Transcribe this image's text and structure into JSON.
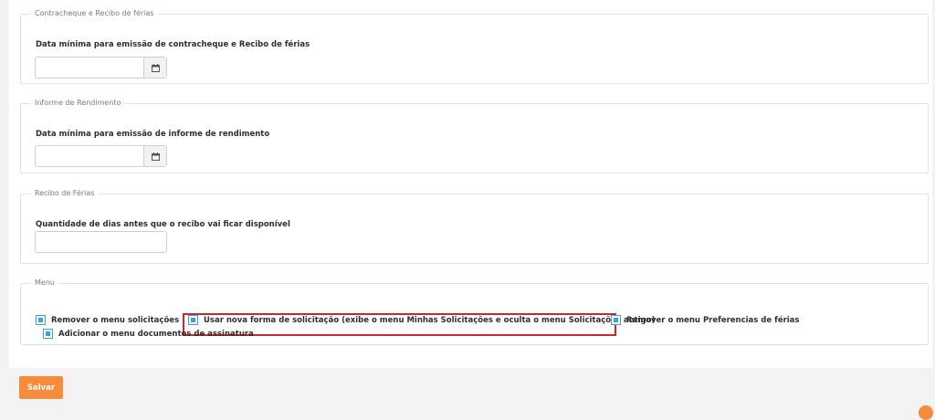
{
  "sections": {
    "contracheque": {
      "legend": "Contracheque e Recibo de férias",
      "label": "Data mínima para emissão de contracheque e Recibo de férias",
      "value": ""
    },
    "informe": {
      "legend": "Informe de Rendimento",
      "label": "Data mínima para emissão de informe de rendimento",
      "value": ""
    },
    "recibo": {
      "legend": "Recibo de Férias",
      "label": "Quantidade de dias antes que o recibo vai ficar disponível",
      "value": ""
    },
    "menu": {
      "legend": "Menu",
      "options": [
        {
          "label": "Remover o menu solicitações",
          "checked": true
        },
        {
          "label": "Usar nova forma de solicitação (exibe o menu Minhas Solicitações e oculta o menu Solicitações antigo)",
          "checked": true
        },
        {
          "label": "Remover o menu Preferencias de férias",
          "checked": true
        },
        {
          "label": "Adicionar o menu documentos de assinatura",
          "checked": true
        }
      ]
    }
  },
  "footer": {
    "save_label": "Salvar"
  },
  "icons": {
    "date": "calendar-icon"
  },
  "colors": {
    "accent": "#f58b3b",
    "checkbox": "#3aa0e0",
    "highlight": "#d0272e"
  }
}
